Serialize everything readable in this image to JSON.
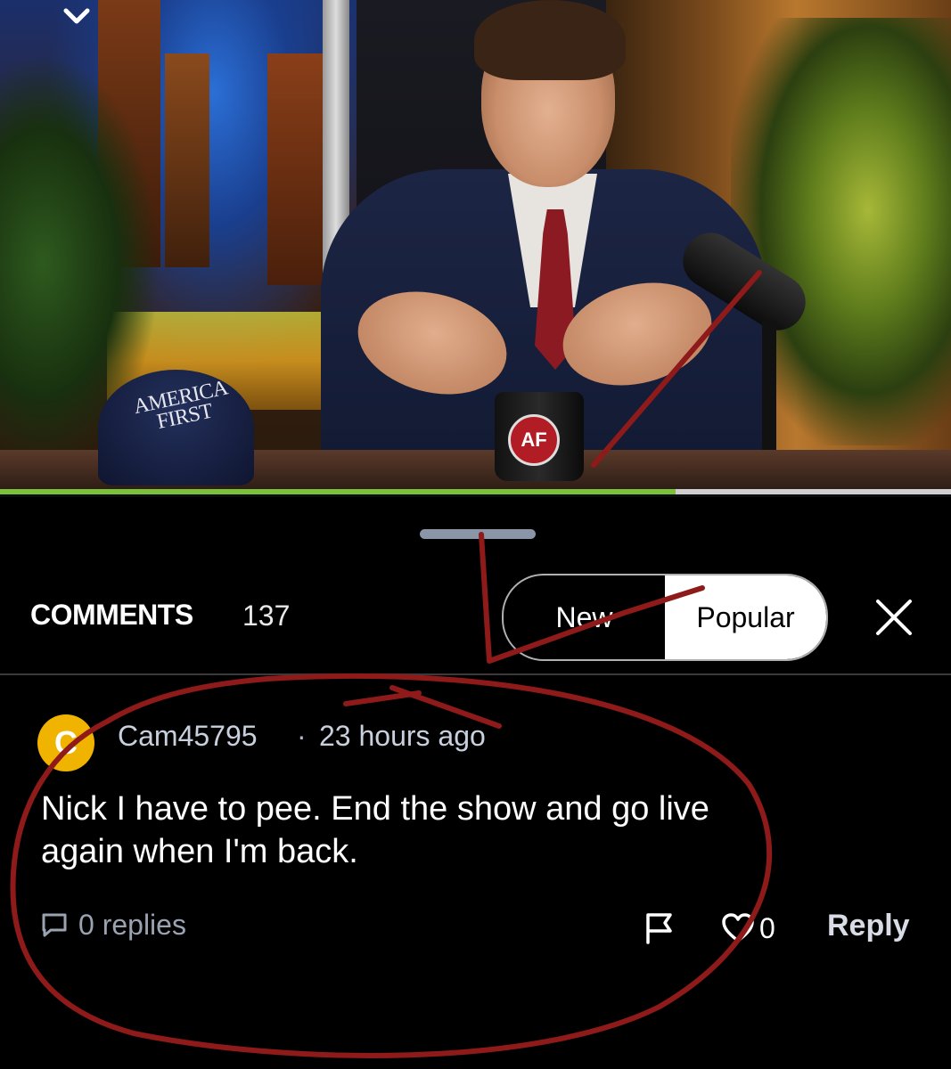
{
  "video": {
    "cap_text": "AMERICA\nFIRST",
    "mug_logo": "AF",
    "progress": 0.71
  },
  "comments": {
    "title": "COMMENTS",
    "count": "137",
    "sort_new": "New",
    "sort_popular": "Popular",
    "active_sort": "Popular"
  },
  "comment": {
    "avatar_letter": "C",
    "username": "Cam45795",
    "separator": "·",
    "time": "23 hours ago",
    "body": "Nick I have to pee. End the show and go live again when I'm back.",
    "replies": "0 replies",
    "likes": "0",
    "reply_label": "Reply"
  },
  "colors": {
    "avatar": "#f0b400",
    "progress_fill": "#7bc23a",
    "annotation_red": "#8e1a1a"
  },
  "icons": [
    "chevron-down-icon",
    "close-icon",
    "comment-bubble-icon",
    "flag-icon",
    "heart-icon"
  ]
}
